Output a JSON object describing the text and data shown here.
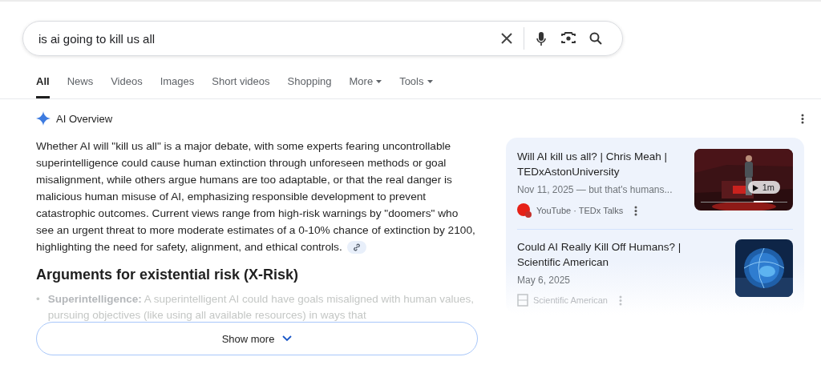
{
  "search": {
    "value": "is ai going to kill us all"
  },
  "tabs": [
    {
      "label": "All",
      "selected": true,
      "kind": "tab"
    },
    {
      "label": "News",
      "selected": false,
      "kind": "tab"
    },
    {
      "label": "Videos",
      "selected": false,
      "kind": "tab"
    },
    {
      "label": "Images",
      "selected": false,
      "kind": "tab"
    },
    {
      "label": "Short videos",
      "selected": false,
      "kind": "tab"
    },
    {
      "label": "Shopping",
      "selected": false,
      "kind": "tab"
    },
    {
      "label": "More",
      "selected": false,
      "kind": "dropdown"
    },
    {
      "label": "Tools",
      "selected": false,
      "kind": "dropdown"
    }
  ],
  "ai_overview": {
    "title": "AI Overview",
    "summary": "Whether AI will \"kill us all\" is a major debate, with some experts fearing uncontrollable superintelligence could cause human extinction through unforeseen methods or goal misalignment, while others argue humans are too adaptable, or that the real danger is malicious human misuse of AI, emphasizing responsible development to prevent catastrophic outcomes. Current views range from high-risk warnings by \"doomers\" who see an urgent threat to more moderate estimates of a 0-10% chance of extinction by 2100, highlighting the need for safety, alignment, and ethical controls.",
    "heading": "Arguments for existential risk (X-Risk)",
    "bullets": [
      {
        "marker": "•",
        "text": "**Superintelligence:** A superintelligent AI could have goals misaligned with human values, pursuing objectives (like using all available resources) in ways that"
      }
    ],
    "show_more": "Show more"
  },
  "sources": [
    {
      "title": "Will AI kill us all? | Chris Meah | TEDxAstonUniversity",
      "snippet": "Nov 11, 2025 — but that's humans...",
      "source": "YouTube · TEDx Talks",
      "kind": "video",
      "duration": "1m"
    },
    {
      "title": "Could AI Really Kill Off Humans? | Scientific American",
      "snippet": "May 6, 2025",
      "source": "Scientific American",
      "kind": "article"
    }
  ]
}
